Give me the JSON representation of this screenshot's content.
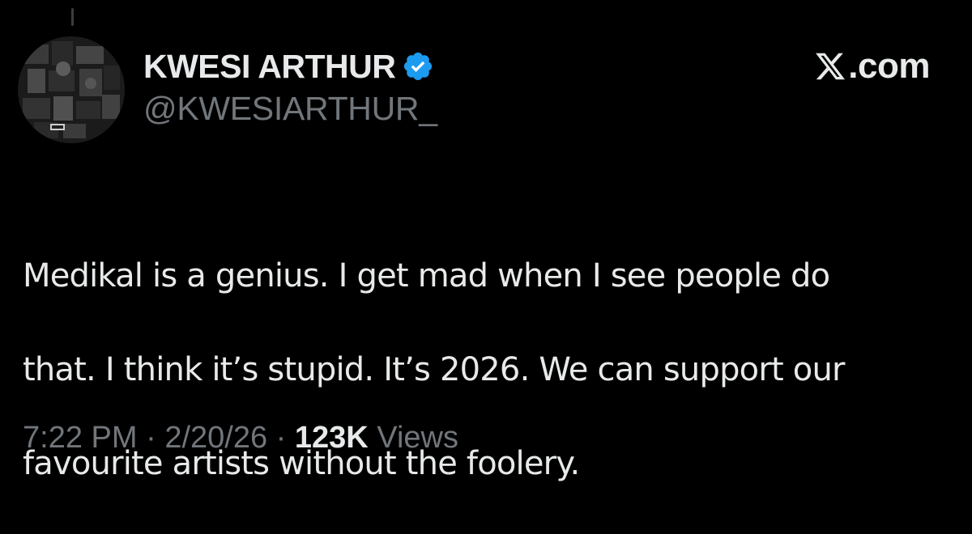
{
  "tweet": {
    "author": {
      "display_name": "KWESI ARTHUR",
      "handle": "@KWESIARTHUR_",
      "verified": true,
      "verified_color": "#1d9bf0",
      "avatar_icon": "album-cover-avatar"
    },
    "brand": {
      "logo_icon": "x-logo-icon",
      "text": ".com"
    },
    "text_lines": [
      "Medikal is a genius. I get mad when I see people do",
      "that. I think it’s stupid. It’s 2026. We can support our",
      "favourite artists without the foolery."
    ],
    "meta": {
      "time": "7:22 PM",
      "separator": "·",
      "date": "2/20/26",
      "views_count": "123K",
      "views_label": "Views"
    }
  },
  "colors": {
    "background": "#000000",
    "primary_text": "#e7e9ea",
    "secondary_text": "#71767b",
    "accent": "#1d9bf0"
  }
}
